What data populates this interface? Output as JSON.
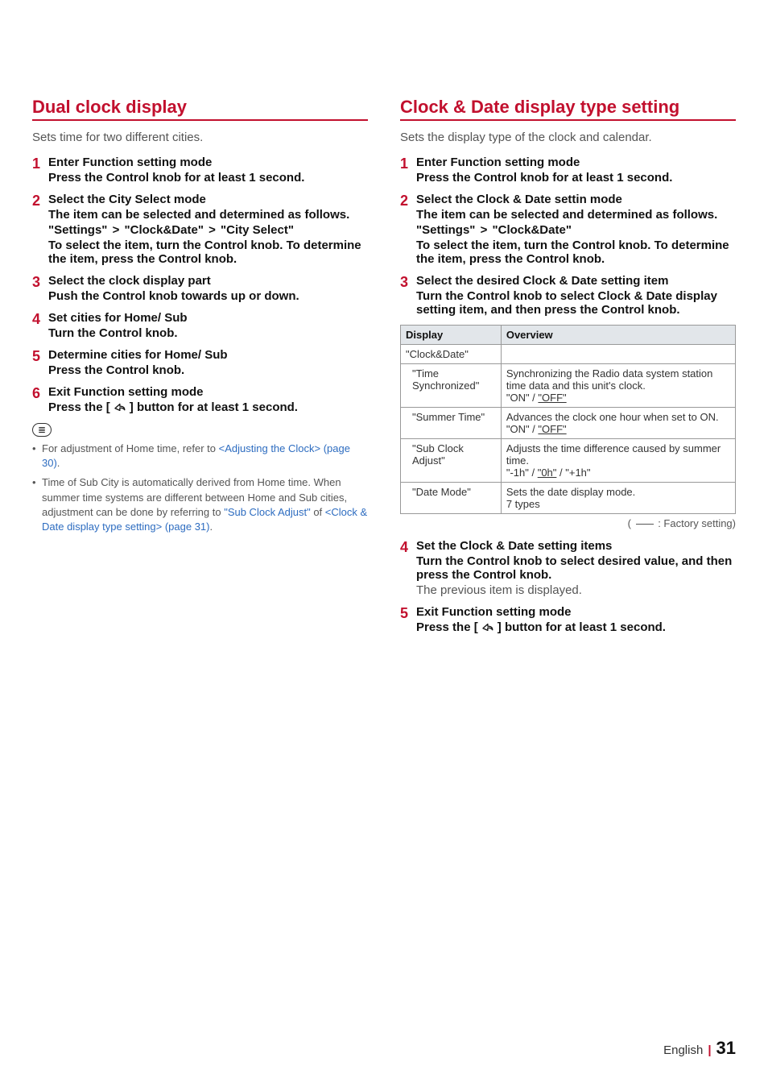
{
  "left": {
    "heading": "Dual clock display",
    "intro": "Sets time for two different cities.",
    "steps": [
      {
        "n": "1",
        "title": "Enter Function setting mode",
        "lines": [
          "Press the Control knob for at least 1 second."
        ]
      },
      {
        "n": "2",
        "title": "Select the City Select mode",
        "lines": [
          "The item can be selected and determined as follows."
        ],
        "path": [
          "\"Settings\"",
          "\"Clock&Date\"",
          "\"City Select\""
        ],
        "after": [
          "To select the item, turn the Control knob. To determine the item, press the Control knob."
        ]
      },
      {
        "n": "3",
        "title": "Select the clock display part",
        "lines": [
          "Push the Control knob towards up or down."
        ]
      },
      {
        "n": "4",
        "title": "Set cities for Home/ Sub",
        "lines": [
          "Turn the Control knob."
        ]
      },
      {
        "n": "5",
        "title": "Determine cities for Home/ Sub",
        "lines": [
          "Press the Control knob."
        ]
      },
      {
        "n": "6",
        "title": "Exit Function setting mode",
        "lines_return": "Press the [ @RET ] button for at least 1 second."
      }
    ],
    "notes": {
      "b1_pre": "For adjustment of Home time, refer to ",
      "b1_link": "<Adjusting the Clock> (page 30)",
      "b1_post": ".",
      "b2_pre": "Time of Sub City is automatically derived from Home time. When summer time systems are different between Home and Sub cities, adjustment can be done by referring to ",
      "b2_l1": "\"Sub Clock Adjust\"",
      "b2_mid": " of ",
      "b2_l2": "<Clock & Date display type setting> (page 31)",
      "b2_post": "."
    }
  },
  "right": {
    "heading": "Clock & Date display type setting",
    "intro": "Sets the display type of the clock and calendar.",
    "steps_top": [
      {
        "n": "1",
        "title": "Enter Function setting mode",
        "lines": [
          "Press the Control knob for at least 1 second."
        ]
      },
      {
        "n": "2",
        "title": "Select the Clock & Date settin mode",
        "lines": [
          "The item can be selected and determined as follows."
        ],
        "path": [
          "\"Settings\"",
          "\"Clock&Date\""
        ],
        "after": [
          "To select the item, turn the Control knob. To determine the item, press the Control knob."
        ]
      },
      {
        "n": "3",
        "title": "Select the desired Clock & Date setting item",
        "lines": [
          "Turn the Control knob to select Clock & Date display setting item, and then press the Control knob."
        ]
      }
    ],
    "table": {
      "h1": "Display",
      "h2": "Overview",
      "group": "\"Clock&Date\"",
      "rows": [
        {
          "d": "\"Time Synchronized\"",
          "o_pre": "Synchronizing the Radio data system station time data and this unit's clock.",
          "o_opt_pre": "\"ON\" / ",
          "o_opt_u": "\"OFF\""
        },
        {
          "d": "\"Summer Time\"",
          "o_pre": "Advances the clock one hour when set to ON.",
          "o_opt_pre": "\"ON\" / ",
          "o_opt_u": "\"OFF\""
        },
        {
          "d": "\"Sub Clock Adjust\"",
          "o_pre": "Adjusts the time difference caused by summer time.",
          "o_opt_pre": "\"-1h\" / ",
          "o_opt_u": "\"0h\"",
          "o_opt_post": " / \"+1h\""
        },
        {
          "d": "\"Date Mode\"",
          "o_pre": "Sets the date display mode.",
          "o_opt_pre": "7 types"
        }
      ]
    },
    "factory": ": Factory setting)",
    "steps_bottom": [
      {
        "n": "4",
        "title": "Set the Clock & Date setting items",
        "lines": [
          "Turn the Control knob to select desired value, and then press the Control knob."
        ],
        "plain": "The previous item is displayed."
      },
      {
        "n": "5",
        "title": "Exit Function setting mode",
        "lines_return": "Press the [ @RET ] button for at least 1 second."
      }
    ]
  },
  "footer": {
    "lang": "English",
    "page": "31"
  }
}
